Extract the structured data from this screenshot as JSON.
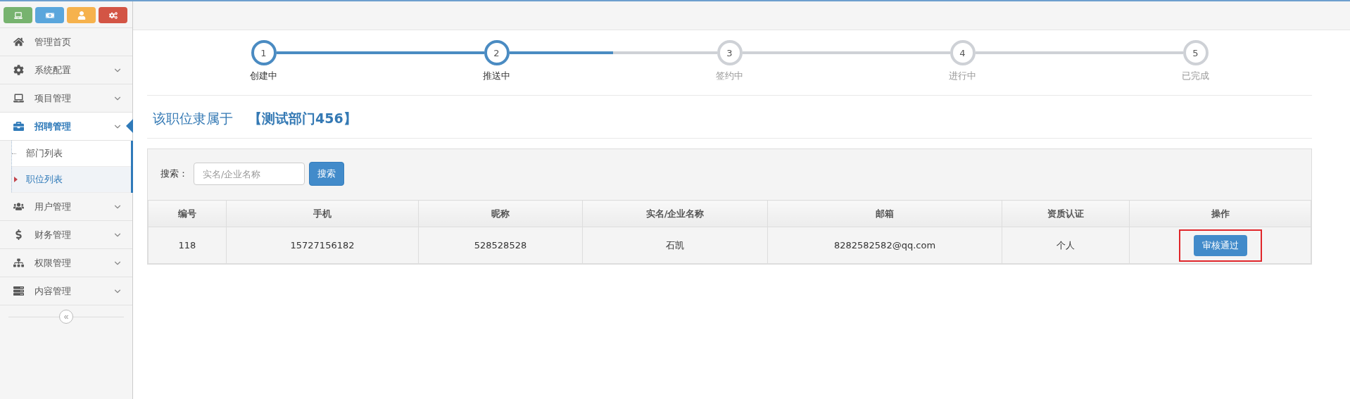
{
  "shortcuts": [
    {
      "kind": "laptop",
      "color": "#77b36f"
    },
    {
      "kind": "money",
      "color": "#5aa6dc"
    },
    {
      "kind": "user",
      "color": "#f6b24d"
    },
    {
      "kind": "cogs",
      "color": "#d35545"
    }
  ],
  "sidebar": {
    "items": [
      {
        "kind": "link",
        "label": "管理首页",
        "expanded": false
      },
      {
        "kind": "group",
        "label": "系统配置",
        "expanded": false
      },
      {
        "kind": "group",
        "label": "项目管理",
        "expanded": false
      },
      {
        "kind": "group",
        "label": "招聘管理",
        "expanded": true,
        "children": [
          {
            "label": "部门列表",
            "selected": false
          },
          {
            "label": "职位列表",
            "selected": true
          }
        ]
      },
      {
        "kind": "group",
        "label": "用户管理",
        "expanded": false
      },
      {
        "kind": "group",
        "label": "财务管理",
        "expanded": false
      },
      {
        "kind": "group",
        "label": "权限管理",
        "expanded": false
      },
      {
        "kind": "group",
        "label": "内容管理",
        "expanded": false
      }
    ],
    "collapse": "«"
  },
  "steps": {
    "items": [
      {
        "number": "1",
        "label": "创建中",
        "active": true,
        "level": 1
      },
      {
        "number": "2",
        "label": "推送中",
        "active": true,
        "level": 0.5
      },
      {
        "number": "3",
        "label": "签约中",
        "active": false,
        "level": 0
      },
      {
        "number": "4",
        "label": "进行中",
        "active": false,
        "level": 0
      },
      {
        "number": "5",
        "label": "已完成",
        "active": false
      }
    ]
  },
  "heading": {
    "text": "该职位隶属于",
    "department": "【测试部门456】"
  },
  "search": {
    "label": "搜索：",
    "placeholder": "实名/企业名称",
    "button": "搜索"
  },
  "table": {
    "columns": [
      "编号",
      "手机",
      "昵称",
      "实名/企业名称",
      "邮箱",
      "资质认证",
      "操作"
    ],
    "rows": [
      {
        "cells": [
          "118",
          "15727156182",
          "528528528",
          "石凯",
          "8282582582@qq.com",
          "个人"
        ],
        "action": "审核通过",
        "highlighted": true
      }
    ]
  }
}
